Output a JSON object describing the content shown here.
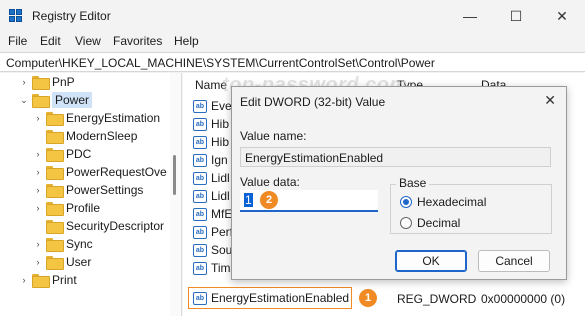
{
  "window": {
    "title": "Registry Editor",
    "minimize": "—",
    "maximize": "☐",
    "close": "✕"
  },
  "menu": [
    "File",
    "Edit",
    "View",
    "Favorites",
    "Help"
  ],
  "address": "Computer\\HKEY_LOCAL_MACHINE\\SYSTEM\\CurrentControlSet\\Control\\Power",
  "tree": {
    "items": [
      {
        "label": "PnP",
        "chev": "›"
      },
      {
        "label": "Power",
        "chev": "⌄"
      },
      {
        "label": "EnergyEstimation",
        "chev": "›"
      },
      {
        "label": "ModernSleep",
        "chev": ""
      },
      {
        "label": "PDC",
        "chev": "›"
      },
      {
        "label": "PowerRequestOve",
        "chev": "›"
      },
      {
        "label": "PowerSettings",
        "chev": "›"
      },
      {
        "label": "Profile",
        "chev": "›"
      },
      {
        "label": "SecurityDescriptor",
        "chev": ""
      },
      {
        "label": "Sync",
        "chev": "›"
      },
      {
        "label": "User",
        "chev": "›"
      },
      {
        "label": "Print",
        "chev": "›"
      }
    ]
  },
  "list": {
    "headers": {
      "name": "Name",
      "type": "Type",
      "data": "Data"
    },
    "values": [
      "Eve",
      "Hib",
      "Hib",
      "Ign",
      "Lidl",
      "Lidl",
      "MfE",
      "Perf",
      "Sou",
      "Tim"
    ],
    "selected": {
      "name": "EnergyEstimationEnabled",
      "type": "REG_DWORD",
      "data": "0x00000000 (0)"
    }
  },
  "watermark": "top-password.com",
  "dialog": {
    "title": "Edit DWORD (32-bit) Value",
    "close": "✕",
    "value_name_label": "Value name:",
    "value_name": "EnergyEstimationEnabled",
    "value_data_label": "Value data:",
    "value_data": "1",
    "base_label": "Base",
    "radio_hex": "Hexadecimal",
    "radio_dec": "Decimal",
    "ok": "OK",
    "cancel": "Cancel"
  },
  "badges": {
    "one": "1",
    "two": "2"
  },
  "colors": {
    "accent": "#1e66c9",
    "highlight": "#f08a24"
  }
}
